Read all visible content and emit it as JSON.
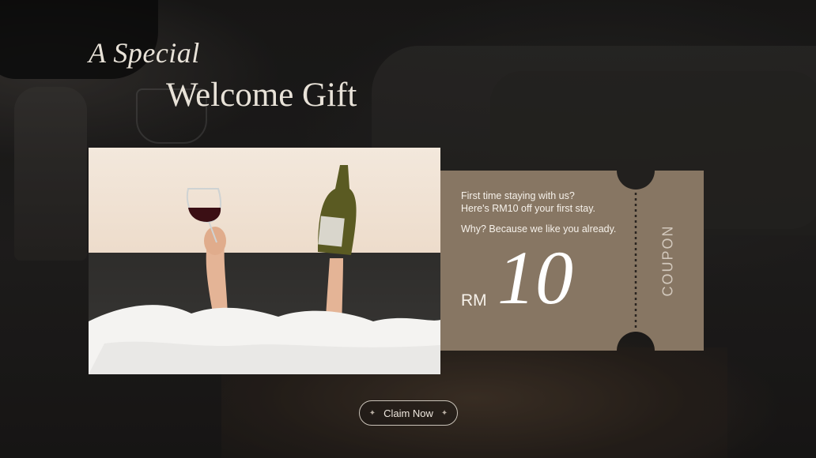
{
  "heading": {
    "line1": "A Special",
    "line2": "Welcome Gift"
  },
  "coupon": {
    "line1": "First time staying with us?",
    "line2": "Here's RM10 off your first stay.",
    "line3": "Why? Because we like you already.",
    "currency": "RM",
    "amount": "10",
    "label": "COUPON",
    "color": "#877663"
  },
  "cta": {
    "label": "Claim Now",
    "left_icon": "sparkle-icon",
    "right_icon": "sparkle-icon"
  },
  "colors": {
    "background": "#1a1816",
    "coupon": "#877663",
    "heading": "#e8e2d8"
  }
}
